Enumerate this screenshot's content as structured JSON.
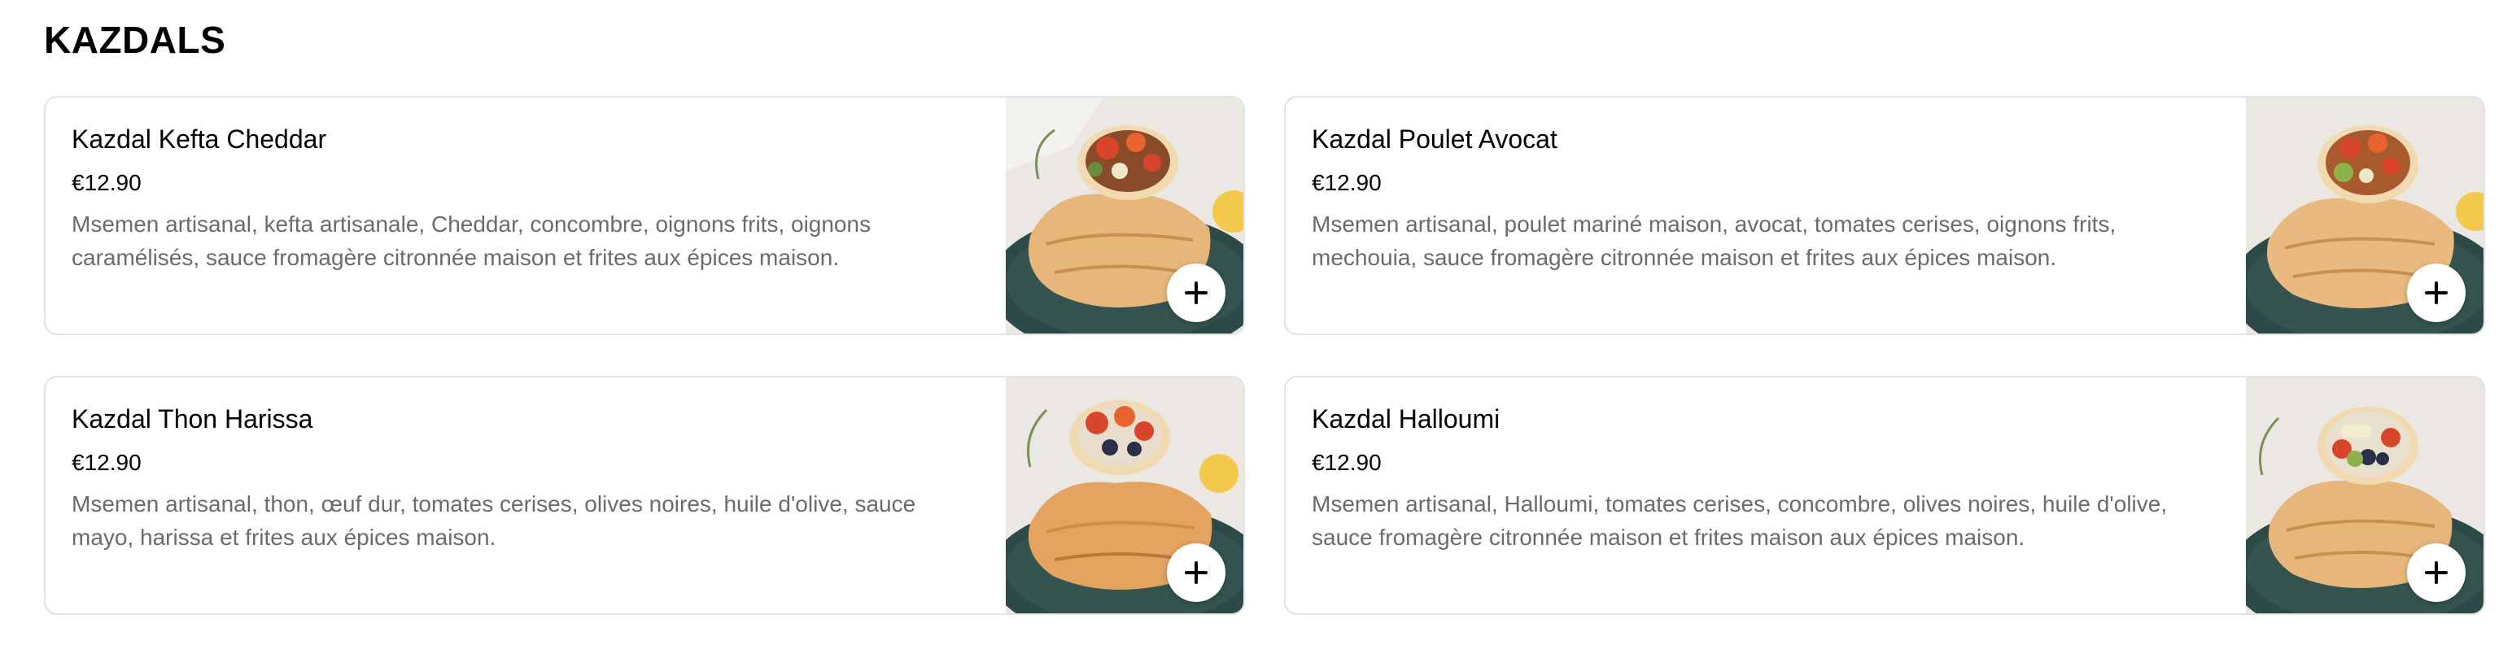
{
  "section": {
    "title": "KAZDALS"
  },
  "items": [
    {
      "name": "Kazdal Kefta Cheddar",
      "price": "€12.90",
      "description": "Msemen artisanal, kefta artisanale, Cheddar, concombre, oignons frits, oignons caramélisés, sauce fromagère citronnée maison et frites aux épices maison.",
      "image_icon": "kefta-wrap-photo",
      "add_icon": "plus-icon"
    },
    {
      "name": "Kazdal Poulet Avocat",
      "price": "€12.90",
      "description": "Msemen artisanal, poulet mariné maison, avocat, tomates cerises, oignons frits, mechouia, sauce fromagère citronnée maison et frites aux épices maison.",
      "image_icon": "chicken-wrap-photo",
      "add_icon": "plus-icon"
    },
    {
      "name": "Kazdal Thon Harissa",
      "price": "€12.90",
      "description": "Msemen artisanal, thon, œuf dur, tomates cerises, olives noires, huile d'olive, sauce mayo, harissa et frites aux épices maison.",
      "image_icon": "tuna-wrap-photo",
      "add_icon": "plus-icon"
    },
    {
      "name": "Kazdal Halloumi",
      "price": "€12.90",
      "description": "Msemen artisanal, Halloumi, tomates cerises, concombre, olives noires, huile d'olive, sauce fromagère citronnée maison et frites maison aux épices maison.",
      "image_icon": "halloumi-wrap-photo",
      "add_icon": "plus-icon"
    }
  ],
  "colors": {
    "text_primary": "#000000",
    "text_secondary": "#6b6b6b",
    "card_border": "#e2e2e2",
    "plate": "#2e4a48",
    "wrap": "#e7b67a",
    "tomato": "#d8452b"
  }
}
